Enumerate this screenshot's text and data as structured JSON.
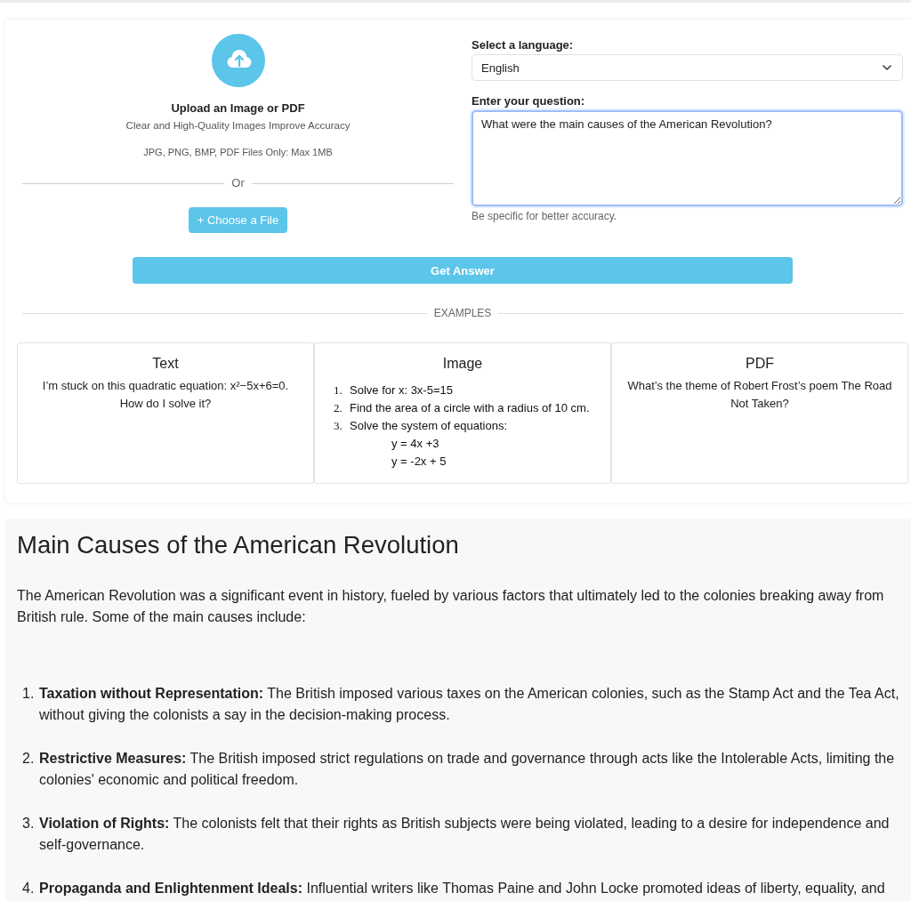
{
  "upload": {
    "title": "Upload an Image or PDF",
    "subtitle": "Clear and High-Quality Images Improve Accuracy",
    "formats": "JPG, PNG, BMP, PDF Files Only: Max 1MB",
    "divider": "Or",
    "button": "+ Choose a File"
  },
  "language": {
    "label": "Select a language:",
    "value": "English"
  },
  "question": {
    "label": "Enter your question:",
    "value": "What were the main causes of the American Revolution?",
    "hint": "Be specific for better accuracy.",
    "focused": true
  },
  "submit_button": "Get Answer",
  "examples": {
    "heading": "EXAMPLES",
    "cards": [
      {
        "kind": "text",
        "title": "Text",
        "text": "I’m stuck on this quadratic equation: x²−5x+6=0. How do I solve it?"
      },
      {
        "kind": "list",
        "title": "Image",
        "items": [
          {
            "number": "1.",
            "text": "Solve for x: 3x-5=15"
          },
          {
            "number": "2.",
            "text": "Find the area of a circle with a radius of 10 cm."
          },
          {
            "number": "3.",
            "text": "Solve the system of equations:",
            "equations": [
              "y = 4x +3",
              "y = -2x + 5"
            ]
          }
        ]
      },
      {
        "kind": "text",
        "title": "PDF",
        "text": "What’s the theme of Robert Frost’s poem The Road Not Taken?"
      }
    ]
  },
  "answer": {
    "title": "Main Causes of the American Revolution",
    "intro": "The American Revolution was a significant event in history, fueled by various factors that ultimately led to the colonies breaking away from British rule. Some of the main causes include:",
    "causes": [
      {
        "number": "1.",
        "text": "**Taxation without Representation:** The British imposed various taxes on the American colonies, such as the Stamp Act and the Tea Act, without giving the colonists a say in the decision-making process."
      },
      {
        "number": "2.",
        "text": "**Restrictive Measures:** The British imposed strict regulations on trade and governance through acts like the Intolerable Acts, limiting the colonies' economic and political freedom."
      },
      {
        "number": "3.",
        "text": "**Violation of Rights:** The colonists felt that their rights as British subjects were being violated, leading to a desire for independence and self-governance."
      },
      {
        "number": "4.",
        "text": "**Propaganda and Enlightenment Ideals:** Influential writers like Thomas Paine and John Locke promoted ideas of liberty, equality, and"
      }
    ]
  }
}
